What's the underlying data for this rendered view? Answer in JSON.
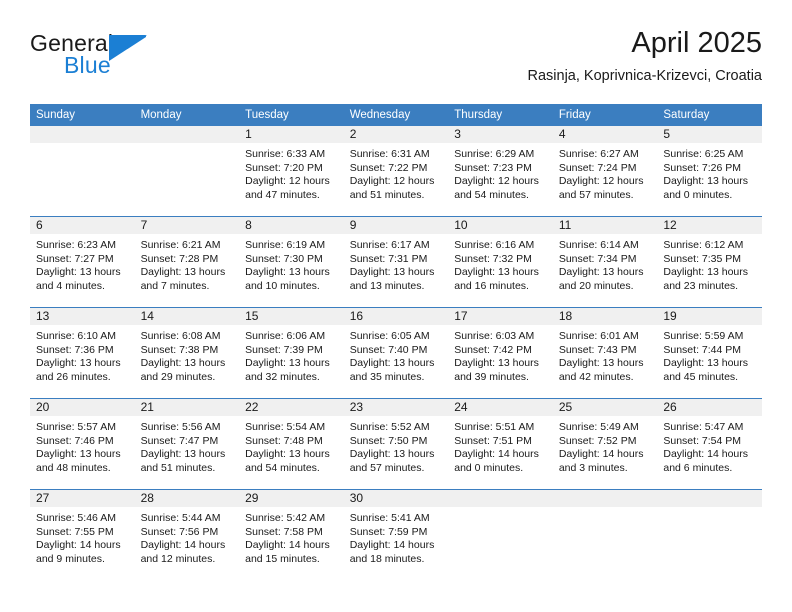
{
  "brand": {
    "name_part1": "General",
    "name_part2": "Blue",
    "logo_icon": "triangle-flag-icon",
    "color_blue": "#1b7fd4"
  },
  "header": {
    "title": "April 2025",
    "subtitle": "Rasinja, Koprivnica-Krizevci, Croatia",
    "header_bg": "#3b7ec0"
  },
  "calendar": {
    "weekday_headers": [
      "Sunday",
      "Monday",
      "Tuesday",
      "Wednesday",
      "Thursday",
      "Friday",
      "Saturday"
    ],
    "weeks": [
      [
        {
          "day": "",
          "lines": [],
          "empty": true
        },
        {
          "day": "",
          "lines": [],
          "empty": true
        },
        {
          "day": "1",
          "lines": [
            "Sunrise: 6:33 AM",
            "Sunset: 7:20 PM",
            "Daylight: 12 hours",
            "and 47 minutes."
          ],
          "empty": false
        },
        {
          "day": "2",
          "lines": [
            "Sunrise: 6:31 AM",
            "Sunset: 7:22 PM",
            "Daylight: 12 hours",
            "and 51 minutes."
          ],
          "empty": false
        },
        {
          "day": "3",
          "lines": [
            "Sunrise: 6:29 AM",
            "Sunset: 7:23 PM",
            "Daylight: 12 hours",
            "and 54 minutes."
          ],
          "empty": false
        },
        {
          "day": "4",
          "lines": [
            "Sunrise: 6:27 AM",
            "Sunset: 7:24 PM",
            "Daylight: 12 hours",
            "and 57 minutes."
          ],
          "empty": false
        },
        {
          "day": "5",
          "lines": [
            "Sunrise: 6:25 AM",
            "Sunset: 7:26 PM",
            "Daylight: 13 hours",
            "and 0 minutes."
          ],
          "empty": false
        }
      ],
      [
        {
          "day": "6",
          "lines": [
            "Sunrise: 6:23 AM",
            "Sunset: 7:27 PM",
            "Daylight: 13 hours",
            "and 4 minutes."
          ],
          "empty": false
        },
        {
          "day": "7",
          "lines": [
            "Sunrise: 6:21 AM",
            "Sunset: 7:28 PM",
            "Daylight: 13 hours",
            "and 7 minutes."
          ],
          "empty": false
        },
        {
          "day": "8",
          "lines": [
            "Sunrise: 6:19 AM",
            "Sunset: 7:30 PM",
            "Daylight: 13 hours",
            "and 10 minutes."
          ],
          "empty": false
        },
        {
          "day": "9",
          "lines": [
            "Sunrise: 6:17 AM",
            "Sunset: 7:31 PM",
            "Daylight: 13 hours",
            "and 13 minutes."
          ],
          "empty": false
        },
        {
          "day": "10",
          "lines": [
            "Sunrise: 6:16 AM",
            "Sunset: 7:32 PM",
            "Daylight: 13 hours",
            "and 16 minutes."
          ],
          "empty": false
        },
        {
          "day": "11",
          "lines": [
            "Sunrise: 6:14 AM",
            "Sunset: 7:34 PM",
            "Daylight: 13 hours",
            "and 20 minutes."
          ],
          "empty": false
        },
        {
          "day": "12",
          "lines": [
            "Sunrise: 6:12 AM",
            "Sunset: 7:35 PM",
            "Daylight: 13 hours",
            "and 23 minutes."
          ],
          "empty": false
        }
      ],
      [
        {
          "day": "13",
          "lines": [
            "Sunrise: 6:10 AM",
            "Sunset: 7:36 PM",
            "Daylight: 13 hours",
            "and 26 minutes."
          ],
          "empty": false
        },
        {
          "day": "14",
          "lines": [
            "Sunrise: 6:08 AM",
            "Sunset: 7:38 PM",
            "Daylight: 13 hours",
            "and 29 minutes."
          ],
          "empty": false
        },
        {
          "day": "15",
          "lines": [
            "Sunrise: 6:06 AM",
            "Sunset: 7:39 PM",
            "Daylight: 13 hours",
            "and 32 minutes."
          ],
          "empty": false
        },
        {
          "day": "16",
          "lines": [
            "Sunrise: 6:05 AM",
            "Sunset: 7:40 PM",
            "Daylight: 13 hours",
            "and 35 minutes."
          ],
          "empty": false
        },
        {
          "day": "17",
          "lines": [
            "Sunrise: 6:03 AM",
            "Sunset: 7:42 PM",
            "Daylight: 13 hours",
            "and 39 minutes."
          ],
          "empty": false
        },
        {
          "day": "18",
          "lines": [
            "Sunrise: 6:01 AM",
            "Sunset: 7:43 PM",
            "Daylight: 13 hours",
            "and 42 minutes."
          ],
          "empty": false
        },
        {
          "day": "19",
          "lines": [
            "Sunrise: 5:59 AM",
            "Sunset: 7:44 PM",
            "Daylight: 13 hours",
            "and 45 minutes."
          ],
          "empty": false
        }
      ],
      [
        {
          "day": "20",
          "lines": [
            "Sunrise: 5:57 AM",
            "Sunset: 7:46 PM",
            "Daylight: 13 hours",
            "and 48 minutes."
          ],
          "empty": false
        },
        {
          "day": "21",
          "lines": [
            "Sunrise: 5:56 AM",
            "Sunset: 7:47 PM",
            "Daylight: 13 hours",
            "and 51 minutes."
          ],
          "empty": false
        },
        {
          "day": "22",
          "lines": [
            "Sunrise: 5:54 AM",
            "Sunset: 7:48 PM",
            "Daylight: 13 hours",
            "and 54 minutes."
          ],
          "empty": false
        },
        {
          "day": "23",
          "lines": [
            "Sunrise: 5:52 AM",
            "Sunset: 7:50 PM",
            "Daylight: 13 hours",
            "and 57 minutes."
          ],
          "empty": false
        },
        {
          "day": "24",
          "lines": [
            "Sunrise: 5:51 AM",
            "Sunset: 7:51 PM",
            "Daylight: 14 hours",
            "and 0 minutes."
          ],
          "empty": false
        },
        {
          "day": "25",
          "lines": [
            "Sunrise: 5:49 AM",
            "Sunset: 7:52 PM",
            "Daylight: 14 hours",
            "and 3 minutes."
          ],
          "empty": false
        },
        {
          "day": "26",
          "lines": [
            "Sunrise: 5:47 AM",
            "Sunset: 7:54 PM",
            "Daylight: 14 hours",
            "and 6 minutes."
          ],
          "empty": false
        }
      ],
      [
        {
          "day": "27",
          "lines": [
            "Sunrise: 5:46 AM",
            "Sunset: 7:55 PM",
            "Daylight: 14 hours",
            "and 9 minutes."
          ],
          "empty": false
        },
        {
          "day": "28",
          "lines": [
            "Sunrise: 5:44 AM",
            "Sunset: 7:56 PM",
            "Daylight: 14 hours",
            "and 12 minutes."
          ],
          "empty": false
        },
        {
          "day": "29",
          "lines": [
            "Sunrise: 5:42 AM",
            "Sunset: 7:58 PM",
            "Daylight: 14 hours",
            "and 15 minutes."
          ],
          "empty": false
        },
        {
          "day": "30",
          "lines": [
            "Sunrise: 5:41 AM",
            "Sunset: 7:59 PM",
            "Daylight: 14 hours",
            "and 18 minutes."
          ],
          "empty": false
        },
        {
          "day": "",
          "lines": [],
          "empty": true
        },
        {
          "day": "",
          "lines": [],
          "empty": true
        },
        {
          "day": "",
          "lines": [],
          "empty": true
        }
      ]
    ]
  }
}
